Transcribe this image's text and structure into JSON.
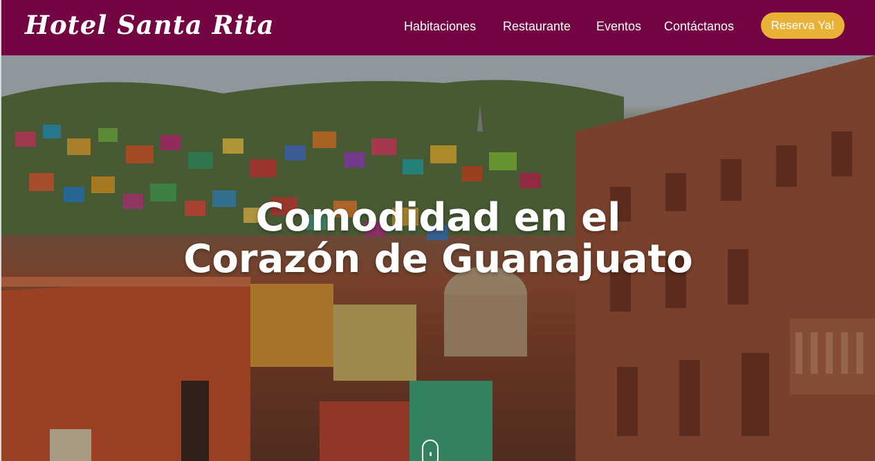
{
  "brand": {
    "logo_text": "Hotel Santa Rita",
    "color": "#730542",
    "accent": "#e9b135"
  },
  "nav": {
    "items": [
      {
        "label": "Habitaciones"
      },
      {
        "label": "Restaurante"
      },
      {
        "label": "Eventos"
      },
      {
        "label": "Contáctanos"
      }
    ],
    "cta_label": "Reserva Ya!"
  },
  "hero": {
    "title_line1": "Comodidad en el",
    "title_line2": "Corazón de Guanajuato",
    "background": "Guanajuato city colorful hillside houses photo",
    "scroll_icon": "mouse-scroll-icon"
  }
}
